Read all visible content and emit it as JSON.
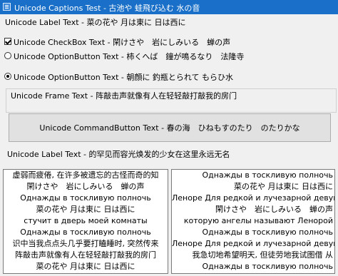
{
  "window": {
    "title": "Unicode Captions Test - 古池や 蛙飛び込む 水の音"
  },
  "controls": {
    "label1": "Unicode Label Text - 菜の花や 月は東に 日は西に",
    "checkbox": {
      "label": "Unicode CheckBox Text - 閑けさや　岩にしみいる　蝉の声",
      "checked": true
    },
    "option1": {
      "label": "Unicode OptionButton Text - 柿くへば　鐘が鳴るなり　法隆寺",
      "selected": false
    },
    "option2": {
      "label": "Unicode OptionButton Text - 朝顔に 釣瓶とられて もらひ水",
      "selected": true
    },
    "frame_caption": "Unicode Frame Text - 阵敲击声就像有人在轻轻敲打敲我的房门",
    "command_button": "Unicode CommandButton Text - 春の海　ひねもすのたり　のたりかな",
    "label2": "Unicode Label Text - 的罕见而容光焕发的少女在这里永远无名"
  },
  "list_left": {
    "items": [
      "虚弱而疲倦, 在许多被遗忘的古怪而奇的知",
      "閑けさや　岩にしみいる　蝉の声",
      "Однажды в тоскливую полночь",
      "菜の花や 月は東に 日は西に",
      "стучит в дверь моей комнаты",
      "Однажды в тоскливую полночь",
      "识中当我点点头几乎要打瞌睡时, 突然传来",
      "阵敲击声就像有人在轻轻敲打敲我的房门",
      "菜の花や 月は東に 日は西に"
    ]
  },
  "list_right": {
    "items": [
      "Однажды в тоскливую полночь",
      "菜の花や 月は東に 日は西に",
      "Леноре Для редкой и лучезарной девушки",
      "閑けさや　岩にしみいる　蝉の声",
      "которую ангелы называют Ленорой",
      "Однажды в тоскливую полночь",
      "Леноре Для редкой и лучезарной девушки",
      "我急切地希望明天, 但徒劳地我试图借 从",
      "Однажды в тоскливую полночь"
    ]
  }
}
